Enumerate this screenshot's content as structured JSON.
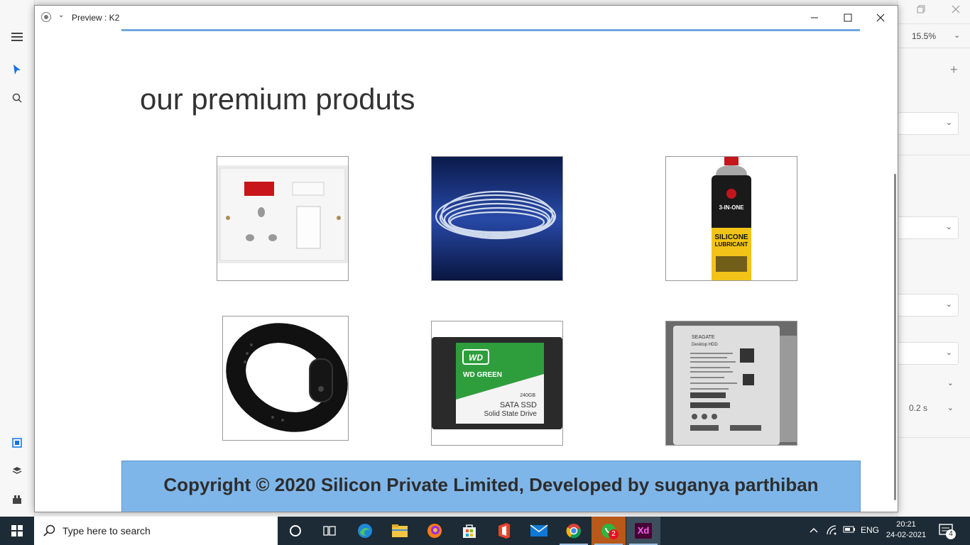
{
  "xd": {
    "zoom": "15.5%",
    "transition_duration": "0.2 s"
  },
  "preview": {
    "title": "Preview : K2",
    "heading": "our premium produts",
    "footer": "Copyright © 2020 Silicon Private Limited, Developed by suganya parthiban",
    "products": [
      {
        "name": "switch-socket"
      },
      {
        "name": "silicone-tube"
      },
      {
        "name": "silicone-lubricant-spray"
      },
      {
        "name": "fitness-band"
      },
      {
        "name": "wd-green-ssd"
      },
      {
        "name": "seagate-hard-drive"
      }
    ]
  },
  "product_labels": {
    "spray_line1": "3-IN-ONE",
    "spray_line2": "SILICONE",
    "spray_line3": "LUBRICANT",
    "ssd_brand": "WD",
    "ssd_line": "WD GREEN",
    "ssd_capacity": "240GB",
    "ssd_type": "SATA SSD",
    "ssd_desc": "Solid State Drive",
    "hdd_brand": "SEAGATE",
    "hdd_model": "Desktop HDD"
  },
  "taskbar": {
    "search_placeholder": "Type here to search",
    "language": "ENG",
    "time": "20:21",
    "date": "24-02-2021",
    "whatsapp_badge": "2",
    "notification_count": "4",
    "xd_label": "Xd"
  }
}
